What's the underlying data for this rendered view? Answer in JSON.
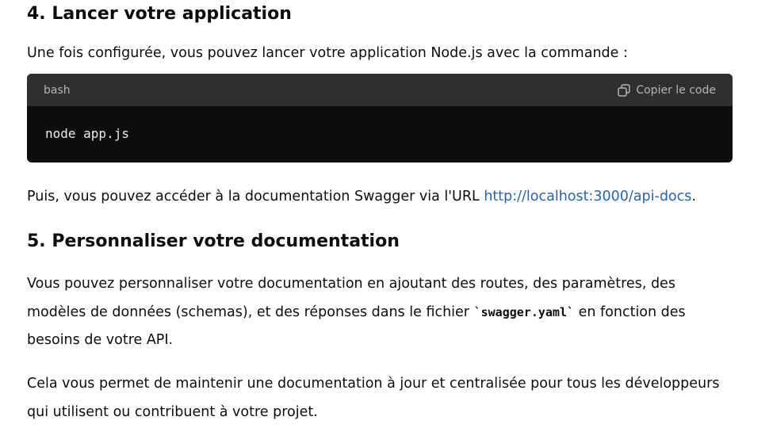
{
  "section4": {
    "heading": "4. Lancer votre application",
    "intro": "Une fois configurée, vous pouvez lancer votre application Node.js avec la commande :"
  },
  "codeblock": {
    "language": "bash",
    "copy_label": "Copier le code",
    "copy_icon": "copy-icon",
    "code": "node app.js"
  },
  "swagger": {
    "text_before": "Puis, vous pouvez accéder à la documentation Swagger via l'URL ",
    "link_text": "http://localhost:3000/api-docs",
    "text_after": "."
  },
  "section5": {
    "heading": "5. Personnaliser votre documentation",
    "custom_before": "Vous pouvez personnaliser votre documentation en ajoutant des routes, des paramètres, des modèles de données (schemas), et des réponses dans le fichier ",
    "custom_code": "`swagger.yaml`",
    "custom_after": " en fonction des besoins de votre API.",
    "central": "Cela vous permet de maintenir une documentation à jour et centralisée pour tous les développeurs qui utilisent ou contribuent à votre projet."
  },
  "colors": {
    "text": "#0d0d0d",
    "link": "#2964aa",
    "code_bg": "#0d0d0d",
    "code_header_bg": "#2f2f2f"
  }
}
